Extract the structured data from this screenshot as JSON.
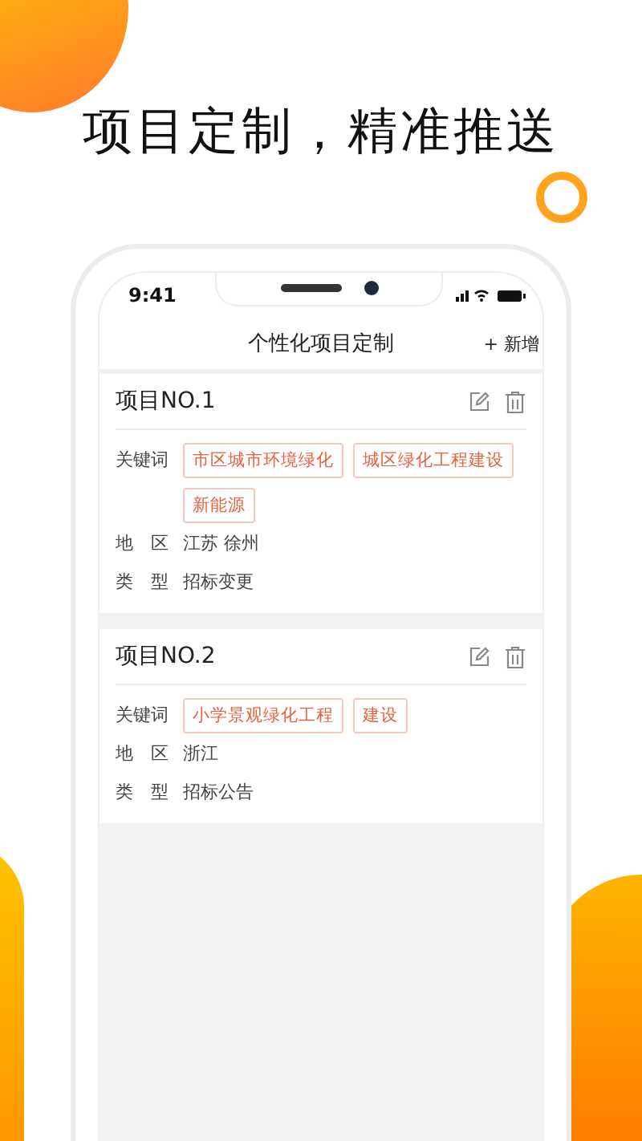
{
  "headline": "项目定制，精准推送",
  "status_bar": {
    "time": "9:41"
  },
  "nav": {
    "title": "个性化项目定制",
    "action": "+ 新增"
  },
  "projects": [
    {
      "title": "项目NO.1",
      "fields": [
        {
          "kind": "tags",
          "label": "关键词",
          "tags": [
            "市区城市环境绿化",
            "城区绿化工程建设",
            "新能源"
          ]
        },
        {
          "kind": "text",
          "label": "地　区",
          "value": "江苏 徐州"
        },
        {
          "kind": "text",
          "label": "类　型",
          "value": "招标变更"
        }
      ]
    },
    {
      "title": "项目NO.2",
      "fields": [
        {
          "kind": "tags",
          "label": "关键词",
          "tags": [
            "小学景观绿化工程",
            "建设"
          ]
        },
        {
          "kind": "text",
          "label": "地　区",
          "value": "浙江"
        },
        {
          "kind": "text",
          "label": "类　型",
          "value": "招标公告"
        }
      ]
    }
  ]
}
